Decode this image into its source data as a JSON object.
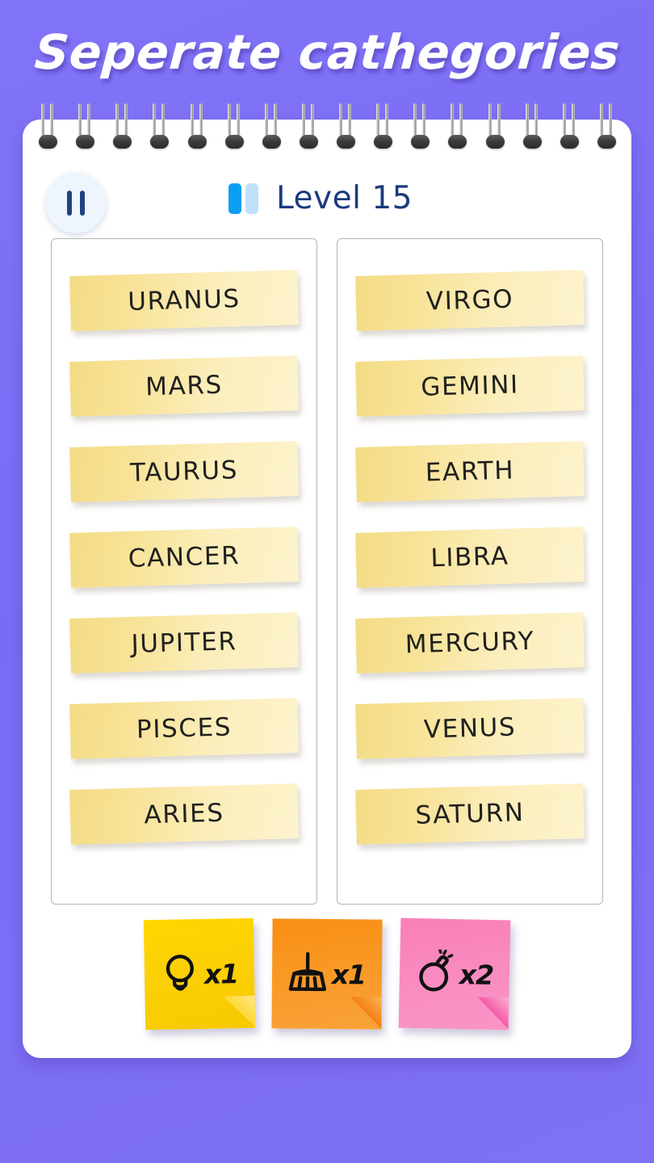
{
  "theme": {
    "background_color": "#7b6cf6",
    "page_color": "#ffffff",
    "tile_color": "#f7e296",
    "accent_blue": "#0c9ef1",
    "level_text_color": "#1b3b7d"
  },
  "header": {
    "title": "Seperate cathegories"
  },
  "toolbar": {
    "pause_icon": "pause-icon",
    "level_label": "Level 15",
    "progress_bars": [
      {
        "state": "filled"
      },
      {
        "state": "empty"
      }
    ]
  },
  "columns": [
    {
      "name": "left-column",
      "tiles": [
        {
          "label": "URANUS"
        },
        {
          "label": "MARS"
        },
        {
          "label": "TAURUS"
        },
        {
          "label": "CANCER"
        },
        {
          "label": "JUPITER"
        },
        {
          "label": "PISCES"
        },
        {
          "label": "ARIES"
        }
      ]
    },
    {
      "name": "right-column",
      "tiles": [
        {
          "label": "VIRGO"
        },
        {
          "label": "GEMINI"
        },
        {
          "label": "EARTH"
        },
        {
          "label": "LIBRA"
        },
        {
          "label": "MERCURY"
        },
        {
          "label": "VENUS"
        },
        {
          "label": "SATURN"
        }
      ]
    }
  ],
  "powerups": [
    {
      "name": "hint",
      "icon": "lightbulb-icon",
      "count": "x1",
      "color": "#fcd90c"
    },
    {
      "name": "clean",
      "icon": "broom-icon",
      "count": "x1",
      "color": "#f89b2a"
    },
    {
      "name": "bomb",
      "icon": "bomb-icon",
      "count": "x2",
      "color": "#f98cc0"
    }
  ],
  "notebook": {
    "spiral_ring_count": 16
  }
}
